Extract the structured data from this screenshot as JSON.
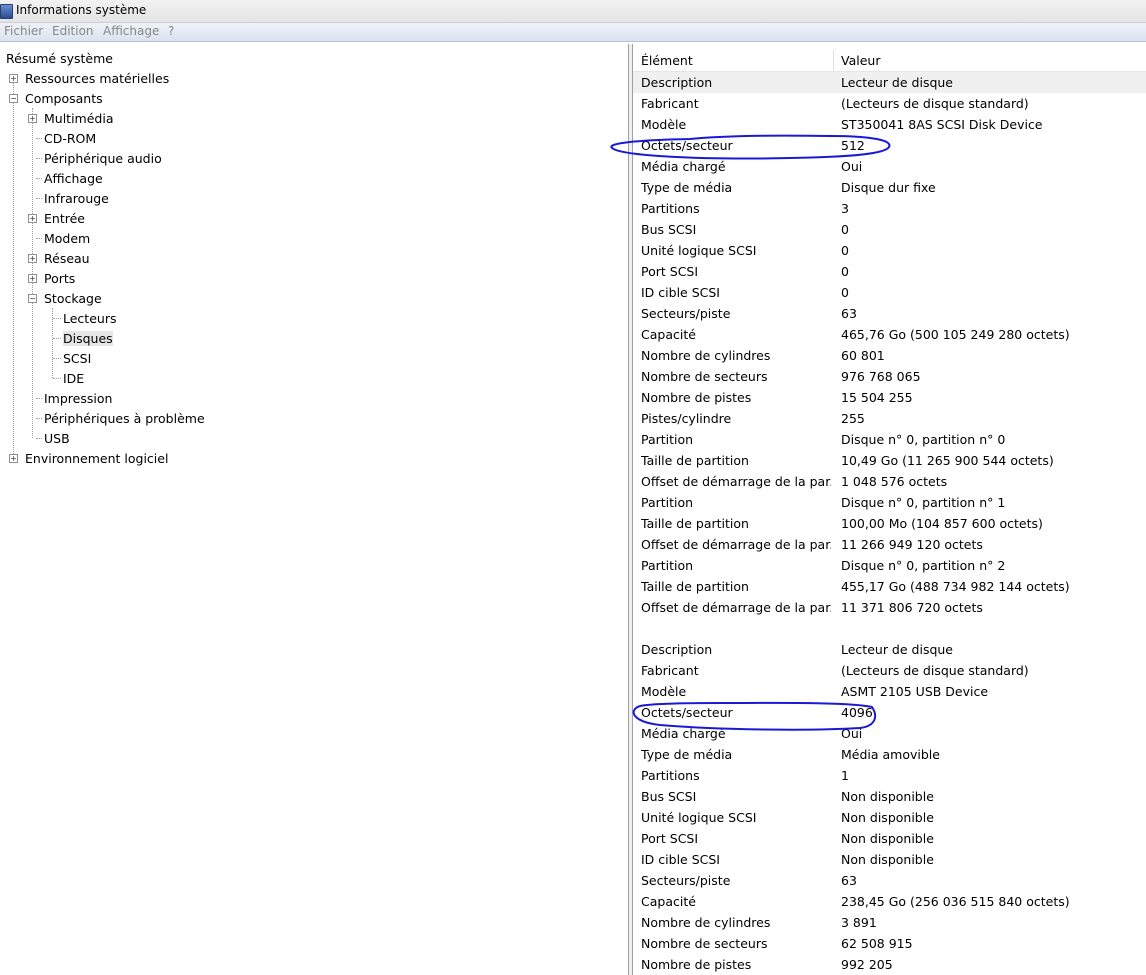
{
  "window": {
    "title": "Informations système"
  },
  "menu": [
    "Fichier",
    "Edition",
    "Affichage",
    "?"
  ],
  "tree": {
    "root": "Résumé système",
    "hardware": "Ressources matérielles",
    "components": "Composants",
    "component_children": [
      "Multimédia",
      "CD-ROM",
      "Périphérique audio",
      "Affichage",
      "Infrarouge",
      "Entrée",
      "Modem",
      "Réseau",
      "Ports",
      "Stockage"
    ],
    "storage_children": [
      "Lecteurs",
      "Disques",
      "SCSI",
      "IDE"
    ],
    "after_storage": [
      "Impression",
      "Périphériques à problème",
      "USB"
    ],
    "software": "Environnement logiciel",
    "selected": "Disques"
  },
  "columns": {
    "element": "Élément",
    "value": "Valeur"
  },
  "rows": [
    {
      "name": "Description",
      "value": "Lecteur de disque"
    },
    {
      "name": "Fabricant",
      "value": "(Lecteurs de disque standard)"
    },
    {
      "name": "Modèle",
      "value": "ST350041 8AS SCSI Disk Device"
    },
    {
      "name": "Octets/secteur",
      "value": "512"
    },
    {
      "name": "Média chargé",
      "value": "Oui"
    },
    {
      "name": "Type de média",
      "value": "Disque dur fixe"
    },
    {
      "name": "Partitions",
      "value": "3"
    },
    {
      "name": "Bus SCSI",
      "value": "0"
    },
    {
      "name": "Unité logique SCSI",
      "value": "0"
    },
    {
      "name": "Port SCSI",
      "value": "0"
    },
    {
      "name": "ID cible SCSI",
      "value": "0"
    },
    {
      "name": "Secteurs/piste",
      "value": "63"
    },
    {
      "name": "Capacité",
      "value": "465,76 Go (500 105 249 280 octets)"
    },
    {
      "name": "Nombre de cylindres",
      "value": "60 801"
    },
    {
      "name": "Nombre de secteurs",
      "value": "976 768 065"
    },
    {
      "name": "Nombre de pistes",
      "value": "15 504 255"
    },
    {
      "name": "Pistes/cylindre",
      "value": "255"
    },
    {
      "name": "Partition",
      "value": "Disque n° 0, partition n° 0"
    },
    {
      "name": "Taille de partition",
      "value": "10,49 Go (11 265 900 544 octets)"
    },
    {
      "name": "Offset de démarrage de la par...",
      "value": "1 048 576 octets"
    },
    {
      "name": "Partition",
      "value": "Disque n° 0, partition n° 1"
    },
    {
      "name": "Taille de partition",
      "value": "100,00 Mo (104 857 600 octets)"
    },
    {
      "name": "Offset de démarrage de la par...",
      "value": "11 266 949 120 octets"
    },
    {
      "name": "Partition",
      "value": "Disque n° 0, partition n° 2"
    },
    {
      "name": "Taille de partition",
      "value": "455,17 Go (488 734 982 144 octets)"
    },
    {
      "name": "Offset de démarrage de la par...",
      "value": "11 371 806 720 octets"
    },
    {
      "name": "",
      "value": ""
    },
    {
      "name": "Description",
      "value": "Lecteur de disque"
    },
    {
      "name": "Fabricant",
      "value": "(Lecteurs de disque standard)"
    },
    {
      "name": "Modèle",
      "value": "ASMT 2105 USB Device"
    },
    {
      "name": "Octets/secteur",
      "value": "4096"
    },
    {
      "name": "Média chargé",
      "value": "Oui"
    },
    {
      "name": "Type de média",
      "value": "Média amovible"
    },
    {
      "name": "Partitions",
      "value": "1"
    },
    {
      "name": "Bus SCSI",
      "value": "Non disponible"
    },
    {
      "name": "Unité logique SCSI",
      "value": "Non disponible"
    },
    {
      "name": "Port SCSI",
      "value": "Non disponible"
    },
    {
      "name": "ID cible SCSI",
      "value": "Non disponible"
    },
    {
      "name": "Secteurs/piste",
      "value": "63"
    },
    {
      "name": "Capacité",
      "value": "238,45 Go (256 036 515 840 octets)"
    },
    {
      "name": "Nombre de cylindres",
      "value": "3 891"
    },
    {
      "name": "Nombre de secteurs",
      "value": "62 508 915"
    },
    {
      "name": "Nombre de pistes",
      "value": "992 205"
    }
  ],
  "annotation_color": "#1a1ad6"
}
